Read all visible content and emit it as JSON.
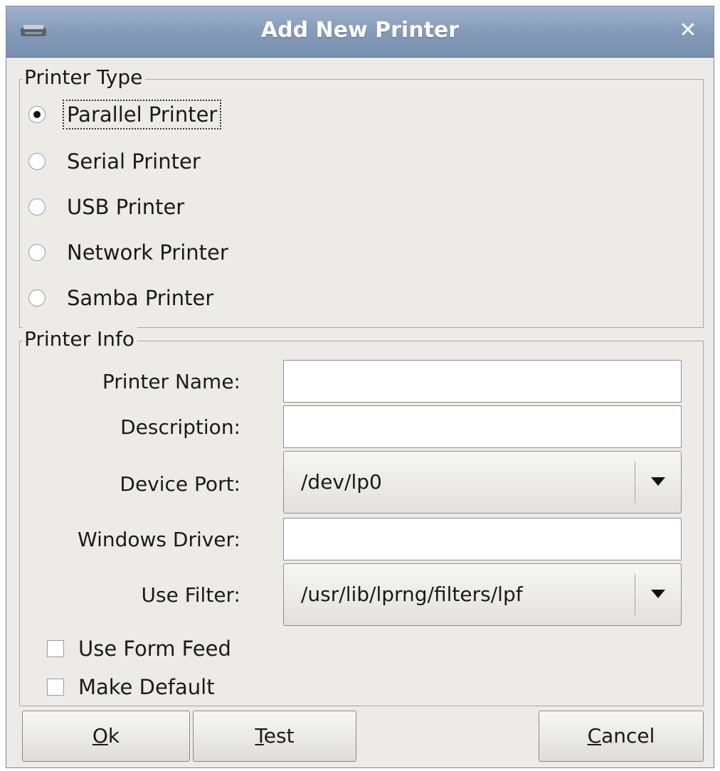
{
  "window": {
    "title": "Add New Printer",
    "close_glyph": "✕",
    "icon": "printer-icon"
  },
  "printer_type": {
    "legend": "Printer Type",
    "options": [
      {
        "label": "Parallel Printer",
        "checked": true
      },
      {
        "label": "Serial Printer",
        "checked": false
      },
      {
        "label": "USB Printer",
        "checked": false
      },
      {
        "label": "Network Printer",
        "checked": false
      },
      {
        "label": "Samba Printer",
        "checked": false
      }
    ]
  },
  "printer_info": {
    "legend": "Printer Info",
    "printer_name_label": "Printer Name:",
    "printer_name_value": "",
    "description_label": "Description:",
    "description_value": "",
    "device_port_label": "Device Port:",
    "device_port_value": "/dev/lp0",
    "windows_driver_label": "Windows Driver:",
    "windows_driver_value": "",
    "use_filter_label": "Use Filter:",
    "use_filter_value": "/usr/lib/lprng/filters/lpf",
    "use_form_feed_label": "Use Form Feed",
    "use_form_feed_checked": false,
    "make_default_label": "Make Default",
    "make_default_checked": false
  },
  "buttons": {
    "ok_mnemonic": "O",
    "ok_rest": "k",
    "test_mnemonic": "T",
    "test_rest": "est",
    "cancel_mnemonic": "C",
    "cancel_rest": "ancel"
  }
}
